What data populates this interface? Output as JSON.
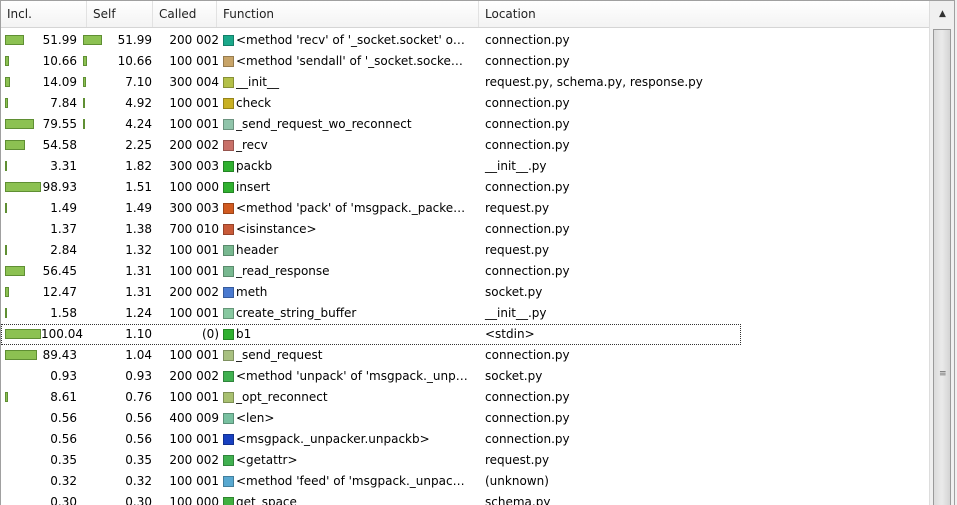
{
  "columns": {
    "incl": "Incl.",
    "self": "Self",
    "called": "Called",
    "function": "Function",
    "location": "Location"
  },
  "rows": [
    {
      "incl": "51.99",
      "incl_pct": 51.99,
      "self": "51.99",
      "self_pct": 51.99,
      "called": "200 002",
      "function": "<method 'recv' of '_socket.socket' o…",
      "location": "connection.py",
      "color": "#1aa88a"
    },
    {
      "incl": "10.66",
      "incl_pct": 10.66,
      "self": "10.66",
      "self_pct": 10.66,
      "called": "100 001",
      "function": "<method 'sendall' of '_socket.socke…",
      "location": "connection.py",
      "color": "#c8a468"
    },
    {
      "incl": "14.09",
      "incl_pct": 14.09,
      "self": "7.10",
      "self_pct": 7.1,
      "called": "300 004",
      "function": "__init__",
      "location": "request.py, schema.py, response.py",
      "color": "#b4c048"
    },
    {
      "incl": "7.84",
      "incl_pct": 7.84,
      "self": "4.92",
      "self_pct": 4.92,
      "called": "100 001",
      "function": "check",
      "location": "connection.py",
      "color": "#c8b024"
    },
    {
      "incl": "79.55",
      "incl_pct": 79.55,
      "self": "4.24",
      "self_pct": 4.24,
      "called": "100 001",
      "function": "_send_request_wo_reconnect",
      "location": "connection.py",
      "color": "#90c4aa"
    },
    {
      "incl": "54.58",
      "incl_pct": 54.58,
      "self": "2.25",
      "self_pct": 2.25,
      "called": "200 002",
      "function": "_recv",
      "location": "connection.py",
      "color": "#c87068"
    },
    {
      "incl": "3.31",
      "incl_pct": 3.31,
      "self": "1.82",
      "self_pct": 1.82,
      "called": "300 003",
      "function": "packb",
      "location": "__init__.py",
      "color": "#30b030"
    },
    {
      "incl": "98.93",
      "incl_pct": 98.93,
      "self": "1.51",
      "self_pct": 1.51,
      "called": "100 000",
      "function": "insert",
      "location": "connection.py",
      "color": "#30b030"
    },
    {
      "incl": "1.49",
      "incl_pct": 1.49,
      "self": "1.49",
      "self_pct": 1.49,
      "called": "300 003",
      "function": "<method 'pack' of 'msgpack._packe…",
      "location": "request.py",
      "color": "#d05a20"
    },
    {
      "incl": "1.37",
      "incl_pct": 1.37,
      "self": "1.38",
      "self_pct": 1.38,
      "called": "700 010",
      "function": "<isinstance>",
      "location": "connection.py",
      "color": "#c85a38"
    },
    {
      "incl": "2.84",
      "incl_pct": 2.84,
      "self": "1.32",
      "self_pct": 1.32,
      "called": "100 001",
      "function": "header",
      "location": "request.py",
      "color": "#78b890"
    },
    {
      "incl": "56.45",
      "incl_pct": 56.45,
      "self": "1.31",
      "self_pct": 1.31,
      "called": "100 001",
      "function": "_read_response",
      "location": "connection.py",
      "color": "#78b890"
    },
    {
      "incl": "12.47",
      "incl_pct": 12.47,
      "self": "1.31",
      "self_pct": 1.31,
      "called": "200 002",
      "function": "meth",
      "location": "socket.py",
      "color": "#4a7ad0"
    },
    {
      "incl": "1.58",
      "incl_pct": 1.58,
      "self": "1.24",
      "self_pct": 1.24,
      "called": "100 001",
      "function": "create_string_buffer",
      "location": "__init__.py",
      "color": "#88c8a0"
    },
    {
      "incl": "100.04",
      "incl_pct": 100.04,
      "self": "1.10",
      "self_pct": 1.1,
      "called": "(0)",
      "function": "b1",
      "location": "<stdin>",
      "color": "#30b030",
      "current": true
    },
    {
      "incl": "89.43",
      "incl_pct": 89.43,
      "self": "1.04",
      "self_pct": 1.04,
      "called": "100 001",
      "function": "_send_request",
      "location": "connection.py",
      "color": "#a8c080"
    },
    {
      "incl": "0.93",
      "incl_pct": 0.93,
      "self": "0.93",
      "self_pct": 0.93,
      "called": "200 002",
      "function": "<method 'unpack' of 'msgpack._unp…",
      "location": "socket.py",
      "color": "#40b050"
    },
    {
      "incl": "8.61",
      "incl_pct": 8.61,
      "self": "0.76",
      "self_pct": 0.76,
      "called": "100 001",
      "function": "_opt_reconnect",
      "location": "connection.py",
      "color": "#a8c070"
    },
    {
      "incl": "0.56",
      "incl_pct": 0.56,
      "self": "0.56",
      "self_pct": 0.56,
      "called": "400 009",
      "function": "<len>",
      "location": "connection.py",
      "color": "#78c0a0"
    },
    {
      "incl": "0.56",
      "incl_pct": 0.56,
      "self": "0.56",
      "self_pct": 0.56,
      "called": "100 001",
      "function": "<msgpack._unpacker.unpackb>",
      "location": "connection.py",
      "color": "#1840c0"
    },
    {
      "incl": "0.35",
      "incl_pct": 0.35,
      "self": "0.35",
      "self_pct": 0.35,
      "called": "200 002",
      "function": "<getattr>",
      "location": "request.py",
      "color": "#40b050"
    },
    {
      "incl": "0.32",
      "incl_pct": 0.32,
      "self": "0.32",
      "self_pct": 0.32,
      "called": "100 001",
      "function": "<method 'feed' of 'msgpack._unpac…",
      "location": "(unknown)",
      "color": "#58a8d0"
    },
    {
      "incl": "0.30",
      "incl_pct": 0.3,
      "self": "0.30",
      "self_pct": 0.3,
      "called": "100 000",
      "function": "get_space",
      "location": "schema.py",
      "color": "#40b040"
    }
  ],
  "scrollbar": {
    "up_icon": "▲",
    "grip_icon": "≡"
  }
}
